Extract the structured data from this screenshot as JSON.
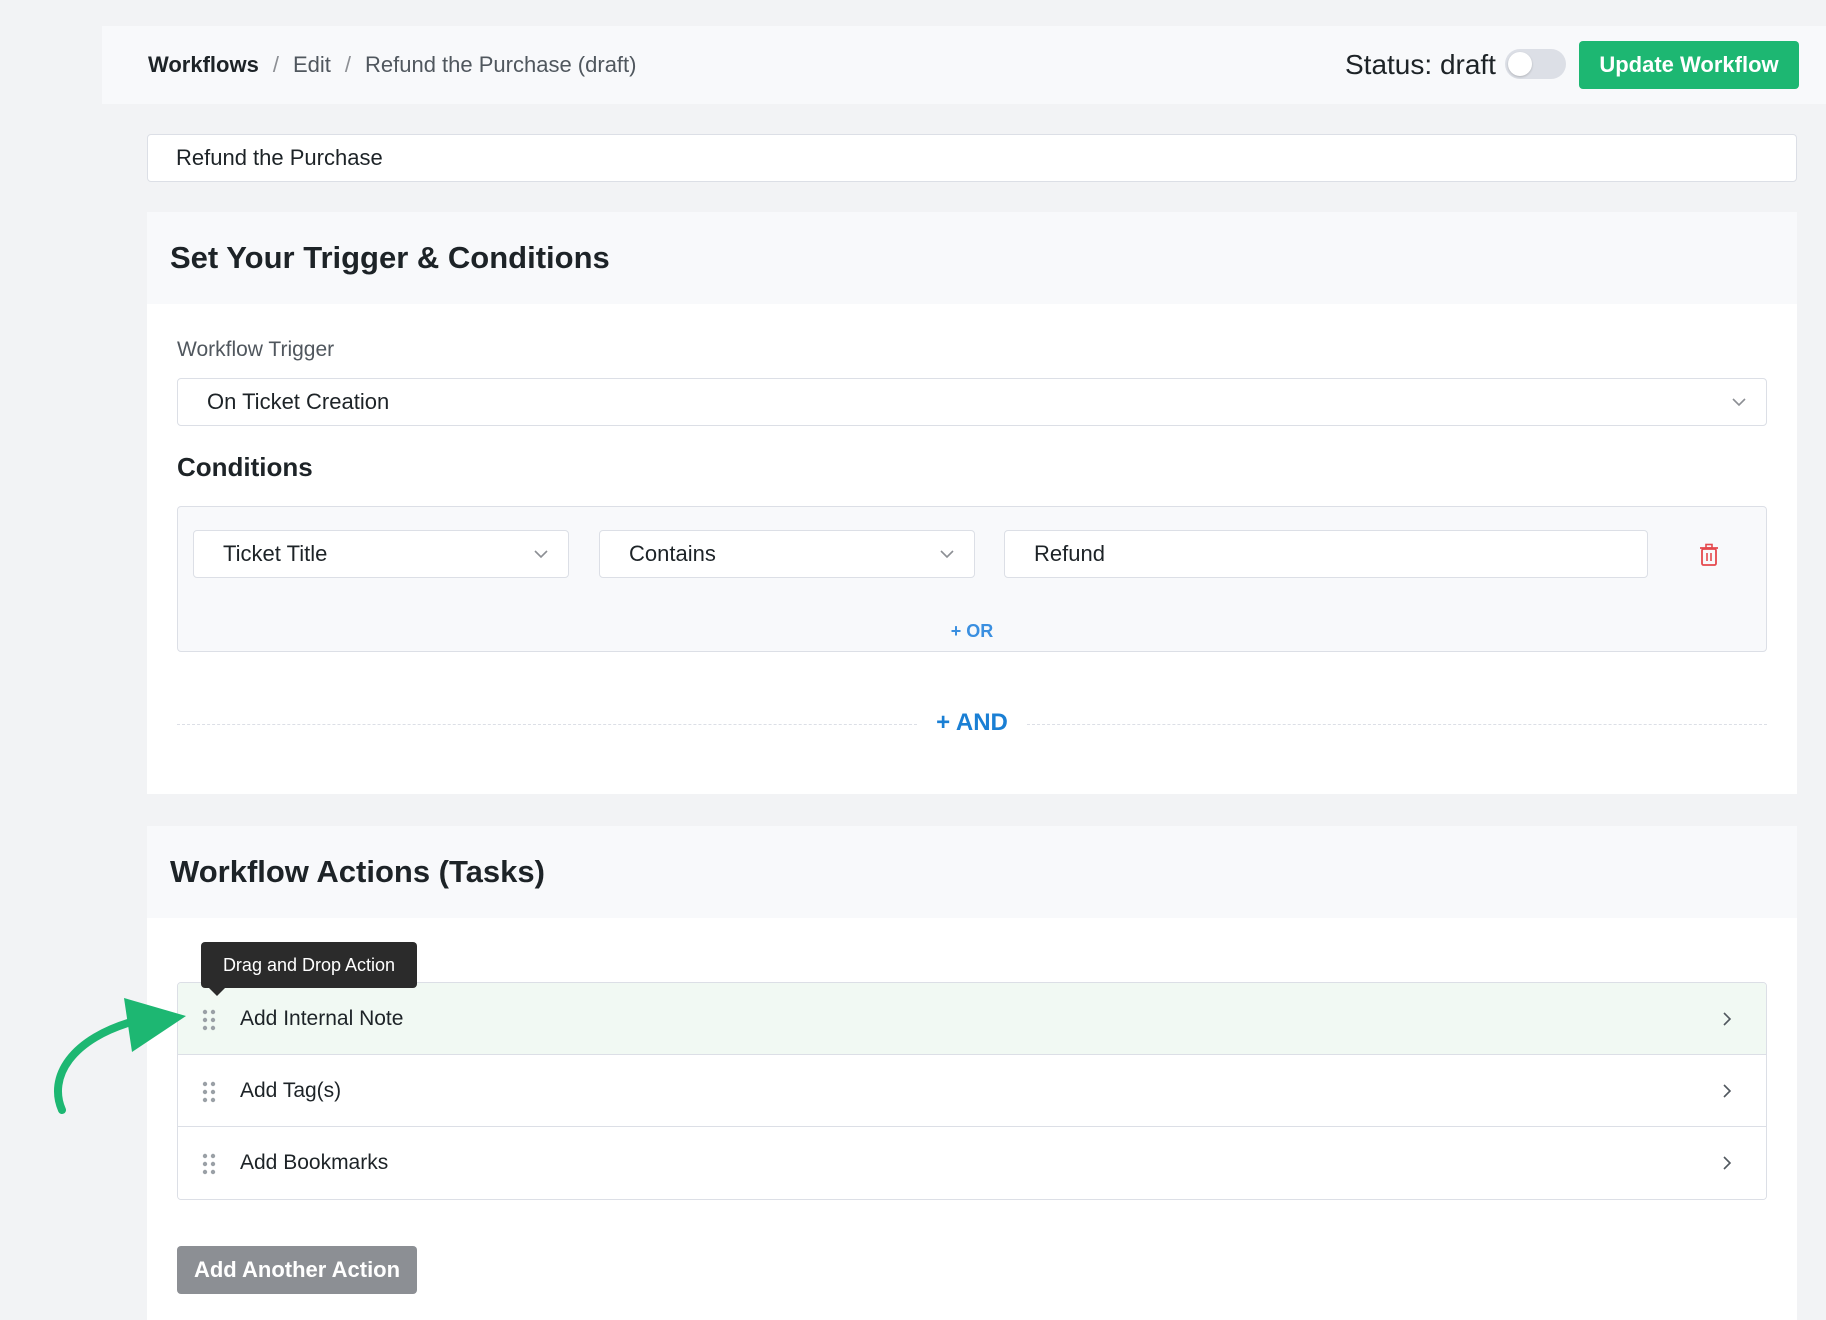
{
  "breadcrumb": {
    "root": "Workflows",
    "separator": "/",
    "edit": "Edit",
    "current": "Refund the Purchase (draft)"
  },
  "status": {
    "label": "Status: draft",
    "toggle_on": false
  },
  "update_button": "Update Workflow",
  "workflow_name": "Refund the Purchase",
  "trigger_section": {
    "title": "Set Your Trigger & Conditions",
    "trigger_label": "Workflow Trigger",
    "trigger_value": "On Ticket Creation",
    "conditions_title": "Conditions",
    "condition": {
      "field": "Ticket Title",
      "operator": "Contains",
      "value": "Refund"
    },
    "or_button": "+ OR",
    "and_button": "+ AND"
  },
  "actions_section": {
    "title": "Workflow Actions (Tasks)",
    "tooltip": "Drag and Drop Action",
    "items": [
      {
        "label": "Add Internal Note"
      },
      {
        "label": "Add Tag(s)"
      },
      {
        "label": "Add Bookmarks"
      }
    ],
    "add_button": "Add Another Action"
  },
  "colors": {
    "accent_green": "#1db772",
    "link_blue": "#1a7fd4",
    "danger_red": "#e5484d"
  }
}
